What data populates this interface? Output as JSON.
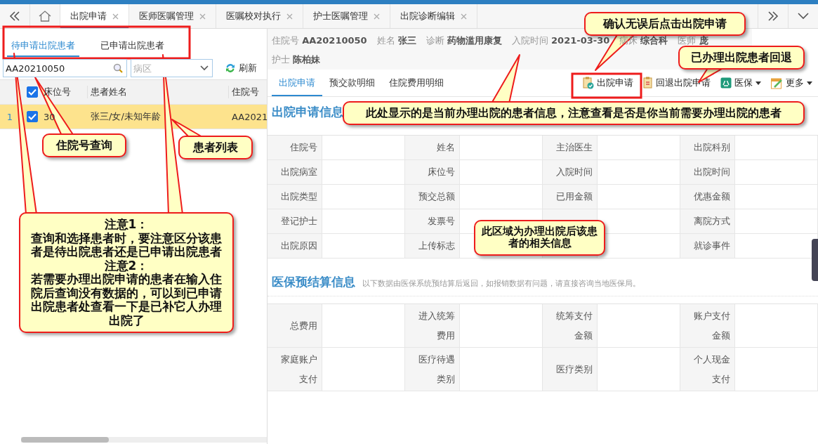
{
  "tab_bar": {
    "tabs": [
      {
        "label": "出院申请",
        "selected": true
      },
      {
        "label": "医师医嘱管理",
        "selected": false
      },
      {
        "label": "医嘱校对执行",
        "selected": false
      },
      {
        "label": "护士医嘱管理",
        "selected": false
      },
      {
        "label": "出院诊断编辑",
        "selected": false
      }
    ]
  },
  "left_panel": {
    "list_tabs": [
      {
        "label": "待申请出院患者",
        "selected": true
      },
      {
        "label": "已申请出院患者",
        "selected": false
      }
    ],
    "search": {
      "value": "AA20210050"
    },
    "ward_select": {
      "placeholder": "病区"
    },
    "refresh_button": {
      "label": "刷新"
    },
    "table": {
      "columns": [
        "床位号",
        "患者姓名",
        "住院号"
      ],
      "header_checked": true,
      "rows": [
        {
          "index": "1",
          "checked": true,
          "selected": true,
          "cells": [
            "30",
            "张三/女/未知年龄",
            "AA2021"
          ]
        }
      ]
    }
  },
  "patient_header": {
    "fields": [
      {
        "label": "住院号",
        "value": "AA20210050"
      },
      {
        "label": "姓名",
        "value": "张三"
      },
      {
        "label": "诊断",
        "value": "药物滥用康复"
      },
      {
        "label": "入院时间",
        "value": "2021-03-30"
      },
      {
        "label": "病床",
        "value": "综合科"
      },
      {
        "label": "医师",
        "value": "庞"
      },
      {
        "label": "护士",
        "value": "陈柏妹"
      }
    ]
  },
  "detail_tabs": [
    {
      "label": "出院申请",
      "selected": true
    },
    {
      "label": "预交款明细",
      "selected": false
    },
    {
      "label": "住院费用明细",
      "selected": false
    }
  ],
  "actions": [
    {
      "label": "出院申请",
      "kind": "apply"
    },
    {
      "label": "回退出院申请",
      "kind": "revoke"
    },
    {
      "label": "医保",
      "kind": "insurance"
    },
    {
      "label": "更多",
      "kind": "more"
    }
  ],
  "discharge_info": {
    "title": "出院申请信息",
    "rows": [
      [
        "住院号",
        "姓名",
        "主治医生",
        "出院科别"
      ],
      [
        "出院病室",
        "床位号",
        "入院时间",
        "出院时间"
      ],
      [
        "出院类型",
        "预交总额",
        "已用金额",
        "优惠金额"
      ],
      [
        "登记护士",
        "发票号",
        null,
        "离院方式"
      ],
      [
        "出院原因",
        "上传标志",
        null,
        "就诊事件"
      ]
    ]
  },
  "insurance_settlement": {
    "title": "医保预结算信息",
    "note": "以下数据由医保系统预结算后返回，如报销数据有问题，请直接咨询当地医保局。",
    "rows": [
      [
        "总费用",
        "进入统筹费用",
        "统筹支付金额",
        "账户支付金额"
      ],
      [
        "家庭账户支付",
        "医疗待遇类别",
        "医疗类别",
        "个人现金支付"
      ]
    ]
  },
  "callouts": [
    {
      "lines": [
        "确认无误后点击出院申请"
      ]
    },
    {
      "lines": [
        "已办理出院患者回退"
      ]
    },
    {
      "lines": [
        "此处显示的是当前办理出院的患者信息，注意查看是否是你当前需要办理出院的患者"
      ]
    },
    {
      "lines": [
        "住院号查询"
      ]
    },
    {
      "lines": [
        "患者列表"
      ]
    },
    {
      "lines": [
        "注意1：",
        "查询和选择患者时，要注意区分该患者是待出院患者还是已申请出院患者",
        "注意2：",
        "若需要办理出院申请的患者在输入住院后查询没有数据的，可以到已申请出院患者处查看一下是已补它人办理出院了"
      ]
    },
    {
      "lines": [
        "此区域为办理出院后该患者的相关信息"
      ]
    }
  ]
}
